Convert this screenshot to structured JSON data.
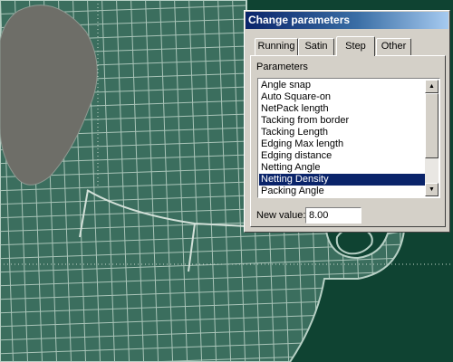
{
  "dialog": {
    "title": "Change parameters",
    "tabs": [
      {
        "label": "Running",
        "active": false
      },
      {
        "label": "Satin",
        "active": false
      },
      {
        "label": "Step",
        "active": true
      },
      {
        "label": "Other",
        "active": false
      }
    ],
    "parameters_label": "Parameters",
    "parameters": [
      "Angle snap",
      "Auto Square-on",
      "NetPack length",
      "Tacking from border",
      "Tacking Length",
      "Edging Max length",
      "Edging distance",
      "Netting Angle",
      "Netting Density",
      "Packing Angle"
    ],
    "selected_parameter": "Netting Density",
    "new_value_label": "New value:",
    "new_value": "8.00"
  },
  "colors": {
    "canvas_background": "#0f4332",
    "shape_fill": "#3b6e5e",
    "grid_lines": "#a9c4b8",
    "gray_region": "#6e6e68",
    "selection": "#0a246a"
  },
  "icons": {
    "scroll_up": "scroll-up-arrow-icon",
    "scroll_down": "scroll-down-arrow-icon"
  }
}
